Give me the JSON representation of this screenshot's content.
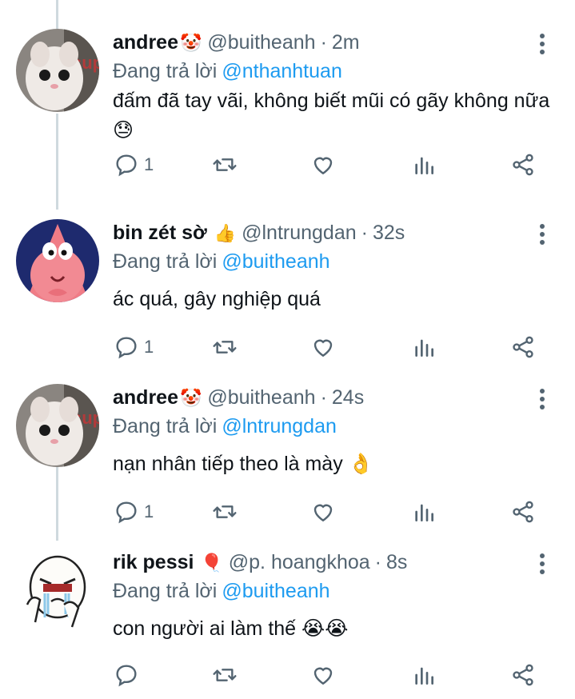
{
  "tweets": [
    {
      "name": "andree",
      "name_emoji": "🤡",
      "handle": "@buitheanh",
      "time": "2m",
      "reply_prefix": "Đang trả lời",
      "reply_to": "@nthanhtuan",
      "text": "đấm đã tay vãi, không biết mũi có gãy không nữa 😓",
      "reply_count": "1",
      "avatar": "cat-avatar"
    },
    {
      "name": "bin zét sờ",
      "name_emoji": "👍",
      "handle": "@lntrungdan",
      "time": "32s",
      "reply_prefix": "Đang trả lời",
      "reply_to": "@buitheanh",
      "text": "ác quá, gây nghiệp quá",
      "reply_count": "1",
      "avatar": "patrick-avatar"
    },
    {
      "name": "andree",
      "name_emoji": "🤡",
      "handle": "@buitheanh",
      "time": "24s",
      "reply_prefix": "Đang trả lời",
      "reply_to": "@lntrungdan",
      "text": "nạn nhân tiếp theo là mày 👌",
      "reply_count": "1",
      "avatar": "cat-avatar"
    },
    {
      "name": "rik pessi",
      "name_emoji": "🎈",
      "handle": "@p. hoangkhoa",
      "time": "8s",
      "reply_prefix": "Đang trả lời",
      "reply_to": "@buitheanh",
      "text": "con người ai làm thế 😭😭",
      "reply_count": "",
      "avatar": "crying-meme-avatar"
    }
  ],
  "colors": {
    "link": "#1d9bf0",
    "muted": "#536471",
    "text": "#0f1419",
    "thread_line": "#cfd9de"
  },
  "icons": {
    "reply": "comment-icon",
    "retweet": "retweet-icon",
    "like": "heart-icon",
    "views": "bar-chart-icon",
    "share": "share-icon",
    "more": "more-vertical-icon"
  }
}
